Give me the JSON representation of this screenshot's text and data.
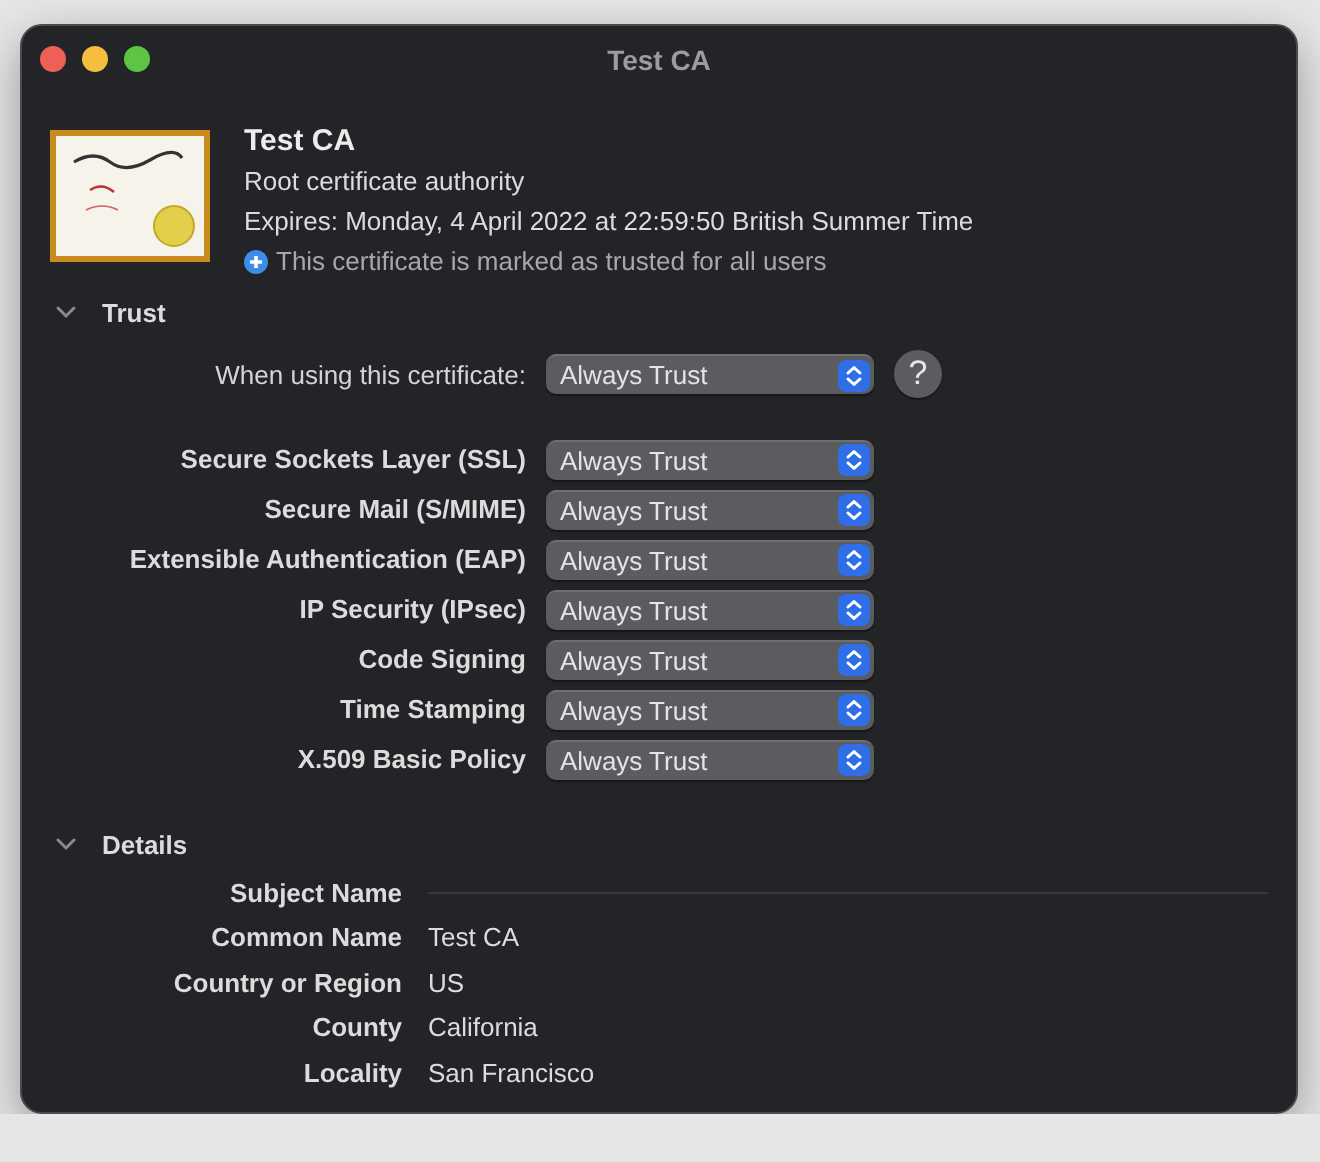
{
  "window": {
    "title": "Test CA"
  },
  "certificate": {
    "name": "Test CA",
    "subtitle": "Root certificate authority",
    "expires": "Expires: Monday, 4 April 2022 at 22:59:50 British Summer Time",
    "trust_note": "This certificate is marked as trusted for all users"
  },
  "trust": {
    "title": "Trust",
    "expanded": true,
    "main": {
      "label": "When using this certificate:",
      "value": "Always Trust"
    },
    "help": "?",
    "policies": [
      {
        "label": "Secure Sockets Layer (SSL)",
        "value": "Always Trust"
      },
      {
        "label": "Secure Mail (S/MIME)",
        "value": "Always Trust"
      },
      {
        "label": "Extensible Authentication (EAP)",
        "value": "Always Trust"
      },
      {
        "label": "IP Security (IPsec)",
        "value": "Always Trust"
      },
      {
        "label": "Code Signing",
        "value": "Always Trust"
      },
      {
        "label": "Time Stamping",
        "value": "Always Trust"
      },
      {
        "label": "X.509 Basic Policy",
        "value": "Always Trust"
      }
    ]
  },
  "details": {
    "title": "Details",
    "expanded": true,
    "rows": [
      {
        "kind": "heading",
        "label": "Subject Name"
      },
      {
        "kind": "field",
        "label": "Common Name",
        "value": "Test CA"
      },
      {
        "kind": "field",
        "label": "Country or Region",
        "value": "US"
      },
      {
        "kind": "field",
        "label": "County",
        "value": "California"
      },
      {
        "kind": "field",
        "label": "Locality",
        "value": "San Francisco"
      }
    ]
  }
}
